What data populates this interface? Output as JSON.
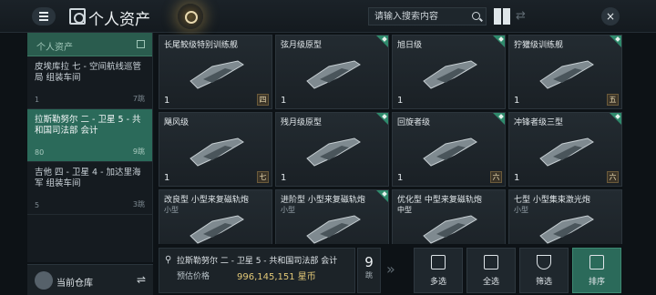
{
  "header": {
    "title": "个人资产",
    "search_placeholder": "请输入搜索内容",
    "close_label": "×"
  },
  "sidebar": {
    "header_label": "个人资产",
    "items": [
      {
        "name": "皮埃库拉 七 - 空间航线巡管局 组装车间",
        "count": "1",
        "total": "7跳"
      },
      {
        "name": "拉斯勒努尔 二 - 卫星 5 - 共和国司法部 会计",
        "count": "80",
        "total": "9跳"
      },
      {
        "name": "吉他 四 - 卫星 4 - 加达里海军 组装车间",
        "count": "5",
        "total": "3跳"
      }
    ],
    "footer_label": "当前仓库"
  },
  "grid": {
    "items": [
      {
        "name": "长尾鲛级特别训练舰",
        "qty": "1",
        "tier": "四",
        "corner": false,
        "sub": ""
      },
      {
        "name": "弦月级原型",
        "qty": "1",
        "tier": "",
        "corner": true,
        "sub": ""
      },
      {
        "name": "旭日级",
        "qty": "1",
        "tier": "",
        "corner": true,
        "sub": ""
      },
      {
        "name": "狞獾级训练舰",
        "qty": "1",
        "tier": "五",
        "corner": true,
        "sub": ""
      },
      {
        "name": "飓风级",
        "qty": "1",
        "tier": "七",
        "corner": false,
        "sub": ""
      },
      {
        "name": "残月级原型",
        "qty": "1",
        "tier": "",
        "corner": true,
        "sub": ""
      },
      {
        "name": "回旋者级",
        "qty": "1",
        "tier": "六",
        "corner": true,
        "sub": ""
      },
      {
        "name": "冲锋者级三型",
        "qty": "1",
        "tier": "六",
        "corner": true,
        "sub": ""
      },
      {
        "name": "改良型 小型来复磁轨炮",
        "qty": "",
        "tier": "",
        "corner": false,
        "sub": "小型"
      },
      {
        "name": "进阶型 小型来复磁轨炮",
        "qty": "",
        "tier": "",
        "corner": true,
        "sub": "小型"
      },
      {
        "name": "优化型 中型来复磁轨炮",
        "qty": "",
        "tier": "",
        "corner": false,
        "sub": "中型"
      },
      {
        "name": "七型 小型集束激光炮",
        "qty": "",
        "tier": "",
        "corner": false,
        "sub": "小型"
      }
    ]
  },
  "footer": {
    "location": "拉斯勒努尔 二 - 卫星 5 - 共和国司法部 会计",
    "price_label": "预估价格",
    "price_value": "996,145,151 星币",
    "jumps": "9",
    "jumps_unit": "跳",
    "actions": [
      "多选",
      "全选",
      "筛选",
      "排序"
    ]
  },
  "colors": {
    "accent": "#2b6a5a",
    "price": "#e2c877"
  }
}
